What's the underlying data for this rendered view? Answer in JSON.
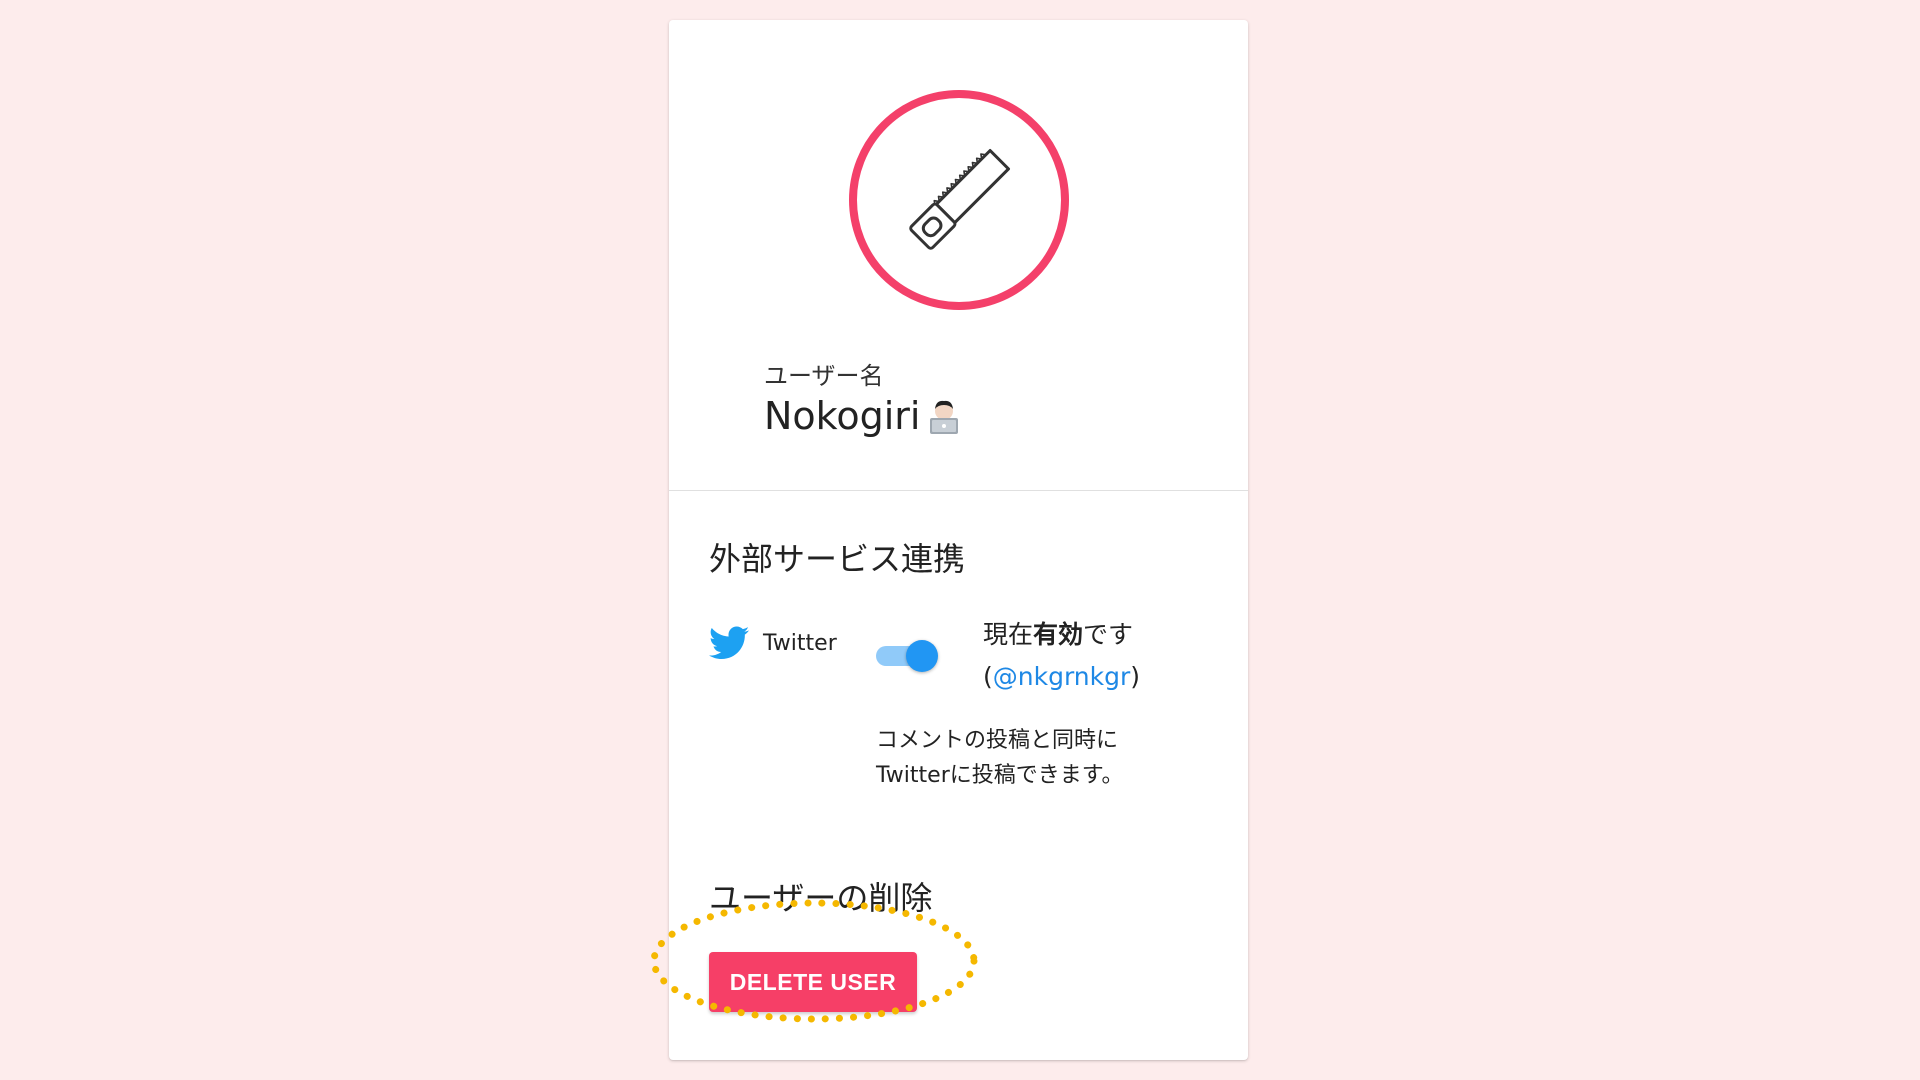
{
  "profile": {
    "username_label": "ユーザー名",
    "username": "Nokogiri",
    "avatar_icon": "saw-icon",
    "emoji_icon": "technologist-emoji"
  },
  "external": {
    "title": "外部サービス連携",
    "service_name": "Twitter",
    "service_icon": "twitter-bird-icon",
    "toggle_on": true,
    "status_prefix": "現在",
    "status_bold": "有効",
    "status_suffix": "です",
    "paren_open": "(",
    "handle": "@nkgrnkgr",
    "paren_close": ")",
    "desc_line1": "コメントの投稿と同時に",
    "desc_line2": "Twitterに投稿できます。"
  },
  "delete": {
    "title": "ユーザーの削除",
    "button_label": "DELETE USER"
  },
  "colors": {
    "background": "#fdecec",
    "avatar_ring": "#f4406a",
    "delete_button": "#f63f67",
    "toggle_thumb": "#2196f3",
    "toggle_track": "#90caf9",
    "link": "#1e88e5",
    "twitter": "#1da1f2",
    "highlight": "#f5b800"
  }
}
